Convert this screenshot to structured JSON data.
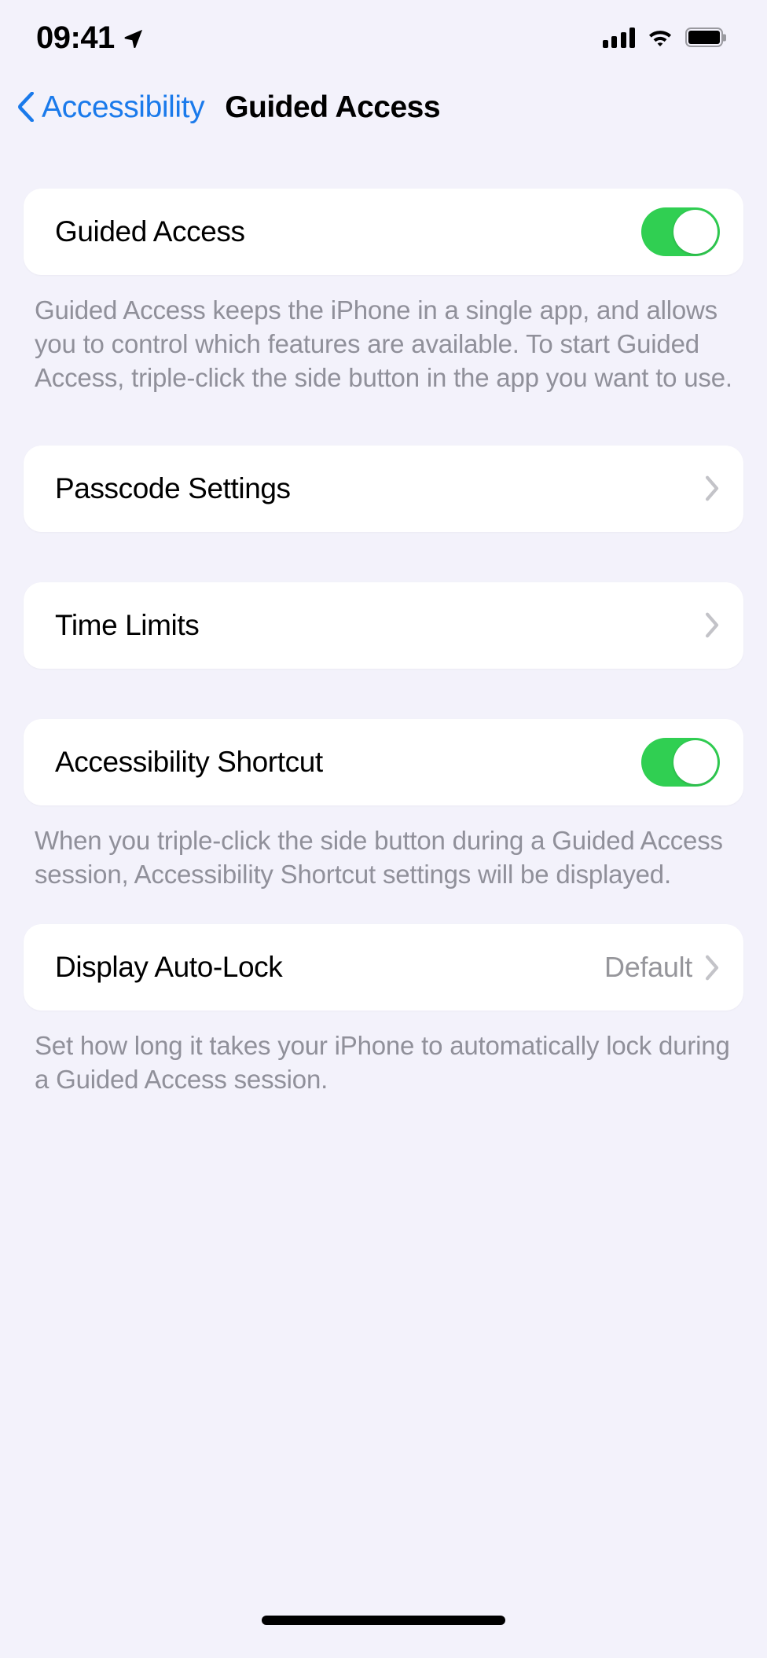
{
  "status_bar": {
    "time": "09:41",
    "location_icon": "location-arrow-icon",
    "cellular_icon": "cellular-bars-icon",
    "wifi_icon": "wifi-icon",
    "battery_icon": "battery-full-icon"
  },
  "nav": {
    "back_icon": "chevron-left-icon",
    "back_label": "Accessibility",
    "title": "Guided Access"
  },
  "sections": {
    "guided_access": {
      "label": "Guided Access",
      "toggle_state": "on",
      "footnote": "Guided Access keeps the iPhone in a single app, and allows you to control which features are available. To start Guided Access, triple-click the side button in the app you want to use."
    },
    "passcode_settings": {
      "label": "Passcode Settings",
      "chevron_icon": "chevron-right-icon"
    },
    "time_limits": {
      "label": "Time Limits",
      "chevron_icon": "chevron-right-icon"
    },
    "accessibility_shortcut": {
      "label": "Accessibility Shortcut",
      "toggle_state": "on",
      "footnote": "When you triple-click the side button during a Guided Access session, Accessibility Shortcut settings will be displayed."
    },
    "display_auto_lock": {
      "label": "Display Auto-Lock",
      "value": "Default",
      "chevron_icon": "chevron-right-icon",
      "footnote": "Set how long it takes your iPhone to automatically lock during a Guided Access session."
    }
  },
  "colors": {
    "background": "#F3F2FB",
    "card": "#FFFFFF",
    "accent_blue": "#1A7AEB",
    "toggle_on_green": "#30CF52",
    "secondary_text": "#90909A"
  }
}
